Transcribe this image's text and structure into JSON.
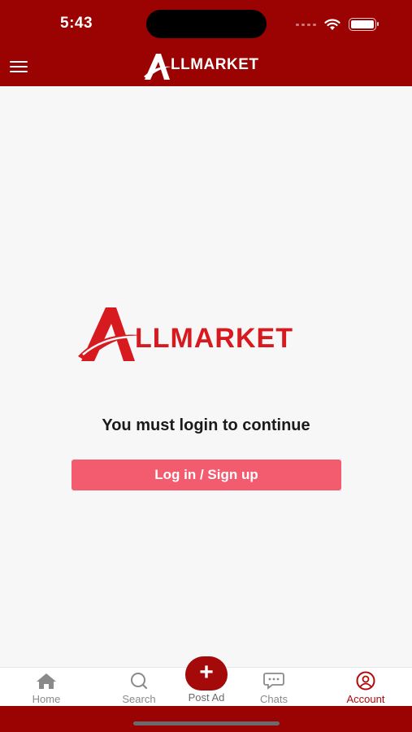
{
  "status_bar": {
    "time": "5:43"
  },
  "header": {
    "brand_logo_text": "LLMARKET"
  },
  "main": {
    "brand_logo_text": "LLMARKET",
    "login_message": "You must login to continue",
    "login_button_label": "Log in / Sign up"
  },
  "bottom_nav": {
    "items": [
      {
        "label": "Home",
        "icon": "home-icon"
      },
      {
        "label": "Search",
        "icon": "search-icon"
      },
      {
        "label": "Post Ad",
        "icon": "plus-icon"
      },
      {
        "label": "Chats",
        "icon": "chat-icon"
      },
      {
        "label": "Account",
        "icon": "account-icon"
      }
    ],
    "active": "Account"
  },
  "colors": {
    "brand_dark_red": "#9b0202",
    "brand_red": "#d71920",
    "button_pink": "#f25c6e",
    "active_tab": "#b00b0b"
  }
}
